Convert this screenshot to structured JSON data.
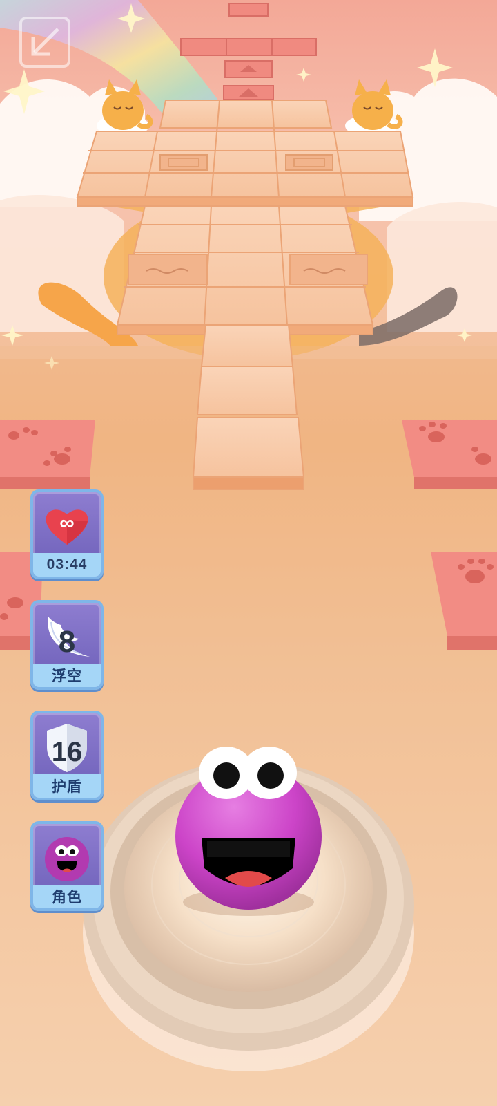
{
  "hud": {
    "back_button": {
      "icon": "back-arrow-icon"
    },
    "powerups": [
      {
        "id": "life",
        "icon": "infinity-heart-icon",
        "symbol": "∞",
        "label": "03:44"
      },
      {
        "id": "float",
        "icon": "wing-icon",
        "count": "8",
        "label": "浮空"
      },
      {
        "id": "shield",
        "icon": "shield-icon",
        "count": "16",
        "label": "护盾"
      },
      {
        "id": "character",
        "icon": "character-face-icon",
        "label": "角色"
      }
    ]
  },
  "colors": {
    "tile": "#f7c6a3",
    "tile_edge": "#e8a070",
    "paw_tile": "#f28c84",
    "ball": "#cc44c8",
    "panel_bg": "#7a6cc4",
    "panel_border": "#7fb6e8",
    "label_bar": "#a5d6f7"
  }
}
